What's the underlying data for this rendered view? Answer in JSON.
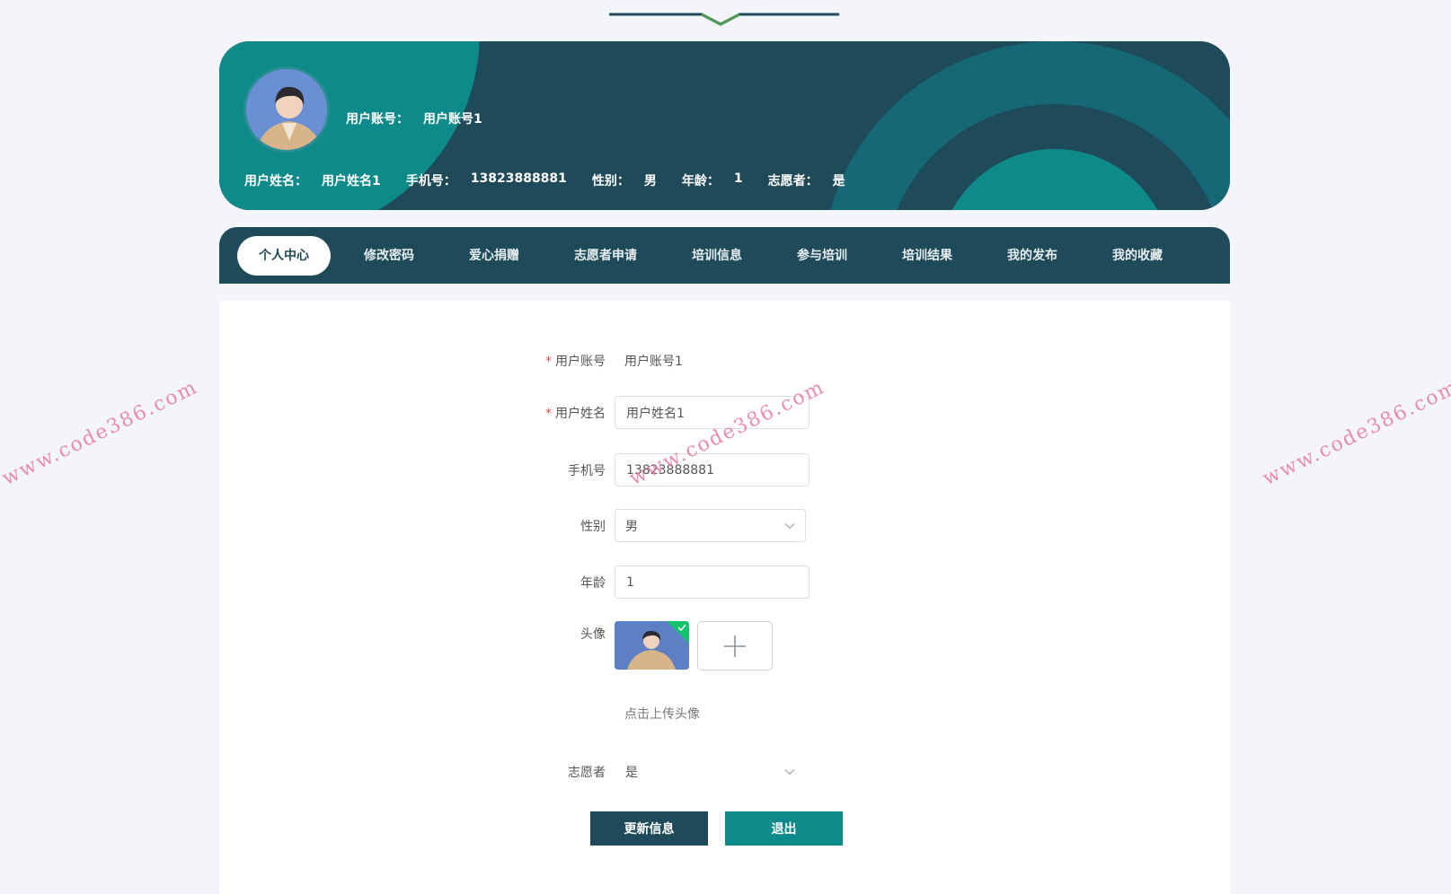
{
  "header": {
    "account_label": "用户账号：",
    "account_value": "用户账号1",
    "name_label": "用户姓名：",
    "name_value": "用户姓名1",
    "phone_label": "手机号：",
    "phone_value": "13823888881",
    "gender_label": "性别：",
    "gender_value": "男",
    "age_label": "年龄：",
    "age_value": "1",
    "volunteer_label": "志愿者：",
    "volunteer_value": "是"
  },
  "nav": {
    "items": [
      "个人中心",
      "修改密码",
      "爱心捐赠",
      "志愿者申请",
      "培训信息",
      "参与培训",
      "培训结果",
      "我的发布",
      "我的收藏"
    ],
    "active_index": 0
  },
  "form": {
    "account": {
      "label": "用户账号",
      "value": "用户账号1"
    },
    "name": {
      "label": "用户姓名",
      "value": "用户姓名1"
    },
    "phone": {
      "label": "手机号",
      "value": "13823888881"
    },
    "gender": {
      "label": "性别",
      "value": "男"
    },
    "age": {
      "label": "年龄",
      "value": "1"
    },
    "avatar": {
      "label": "头像",
      "hint": "点击上传头像"
    },
    "volunteer": {
      "label": "志愿者",
      "value": "是"
    },
    "required_mark": "*"
  },
  "buttons": {
    "update": "更新信息",
    "exit": "退出"
  },
  "watermark": "www.code386.com",
  "colors": {
    "primary": "#1e4a59",
    "teal": "#0f8a8a",
    "background": "#f3f5fb",
    "required": "#e64a4a",
    "watermark": "#e77a9a"
  }
}
